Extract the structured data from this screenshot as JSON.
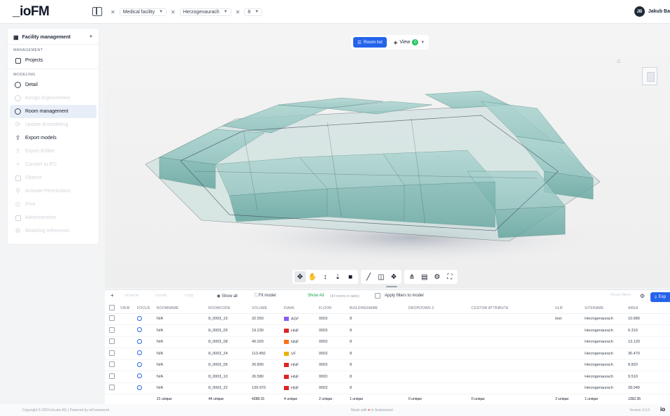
{
  "app": {
    "logo": "_ioFM"
  },
  "breadcrumb": {
    "facility": "Medical facility",
    "site": "Herzogenaurach",
    "level": "8"
  },
  "user": {
    "initials": "JB",
    "name": "Jakub Ba"
  },
  "sidebar": {
    "module": "Facility management",
    "sections": [
      {
        "label": "MANAGEMENT"
      },
      {
        "label": "MODELING"
      }
    ],
    "items": [
      {
        "label": "Projects",
        "icon": "projects-icon"
      },
      {
        "label": "Detail",
        "icon": "info-icon"
      },
      {
        "label": "Assign ifcgeometries",
        "icon": "cube-icon"
      },
      {
        "label": "Room management",
        "icon": "room-cube-icon"
      },
      {
        "label": "Update ifcmodelling",
        "icon": "update-icon"
      },
      {
        "label": "Export models",
        "icon": "export-icon"
      },
      {
        "label": "Export ifcfilter",
        "icon": "export-icon"
      },
      {
        "label": "Convert to IFC",
        "icon": "convert-icon"
      },
      {
        "label": "Objects",
        "icon": "objects-icon"
      },
      {
        "label": "Activate Permissions",
        "icon": "person-icon"
      },
      {
        "label": "Print",
        "icon": "print-icon"
      },
      {
        "label": "Administration",
        "icon": "grid-icon"
      },
      {
        "label": "Modeling references",
        "icon": "gear-icon"
      }
    ]
  },
  "viewer": {
    "room_list_label": "Room list",
    "view_label": "View",
    "view_badge": "0"
  },
  "table": {
    "toolbar": {
      "add": "+",
      "rename": "rename",
      "create": "create",
      "copy": "copy",
      "show_all": "Show all",
      "fit_model": "Fit model",
      "show_all_green": "Show All",
      "rooms_count": "(44 rooms in table)",
      "apply_filters": "Apply filters to model",
      "filter_placeholder": "Reset filters",
      "export": "Exp"
    },
    "columns": [
      "VIEW",
      "FOCUS",
      "ROOMNAME",
      "ROOMCODE",
      "VOLUME",
      "DIA46",
      "FLOOR",
      "BUILDINGNAME",
      "DROPDOWN 2",
      "CUSTOM ATTRIBUTE",
      "ULR",
      "SITENAME",
      "AREA"
    ],
    "rows": [
      {
        "roomname": "N/A",
        "roomcode": "8_0003_15",
        "volume": "32.550",
        "dia46": "AGF",
        "color": "#8b5cf6",
        "floor": "0003",
        "building": "8",
        "ulr": "test",
        "site": "Herzogenaurach",
        "area": "10.680"
      },
      {
        "roomname": "N/A",
        "roomcode": "8_0003_05",
        "volume": "19.230",
        "dia46": "HNF",
        "color": "#dc2626",
        "floor": "0003",
        "building": "8",
        "ulr": "",
        "site": "Herzogenaurach",
        "area": "6.310"
      },
      {
        "roomname": "N/A",
        "roomcode": "8_0003_08",
        "volume": "40.020",
        "dia46": "NNF",
        "color": "#f97316",
        "floor": "0003",
        "building": "8",
        "ulr": "",
        "site": "Herzogenaurach",
        "area": "13.120"
      },
      {
        "roomname": "N/A",
        "roomcode": "8_0003_24",
        "volume": "113.450",
        "dia46": "VF",
        "color": "#eab308",
        "floor": "0003",
        "building": "8",
        "ulr": "",
        "site": "Herzogenaurach",
        "area": "36.470"
      },
      {
        "roomname": "N/A",
        "roomcode": "8_0003_06",
        "volume": "26.890",
        "dia46": "HNF",
        "color": "#dc2626",
        "floor": "0003",
        "building": "8",
        "ulr": "",
        "site": "Herzogenaurach",
        "area": "8.820"
      },
      {
        "roomname": "N/A",
        "roomcode": "8_0003_10",
        "volume": "26.580",
        "dia46": "HNF",
        "color": "#dc2626",
        "floor": "0003",
        "building": "8",
        "ulr": "",
        "site": "Herzogenaurach",
        "area": "9.510"
      },
      {
        "roomname": "N/A",
        "roomcode": "8_0003_22",
        "volume": "139.970",
        "dia46": "HNF",
        "color": "#dc2626",
        "floor": "0003",
        "building": "8",
        "ulr": "",
        "site": "Herzogenaurach",
        "area": "28.040"
      }
    ],
    "summary": {
      "roomname": "21 unique",
      "roomcode": "44 unique",
      "volume": "4288.15",
      "dia46": "4 unique",
      "floor": "2 unique",
      "building": "1 unique",
      "dropdown": "0 unique",
      "custom": "0 unique",
      "ulr": "2 unique",
      "site": "1 unique",
      "area": "1392.35"
    }
  },
  "footer": {
    "copyright": "Copyright © 2024 ioLabs AG  |  Powered by ioFramework",
    "made_with": "Made with",
    "made_in": "in Switzerland",
    "version": "Version 2.6.0",
    "brand": "io"
  }
}
